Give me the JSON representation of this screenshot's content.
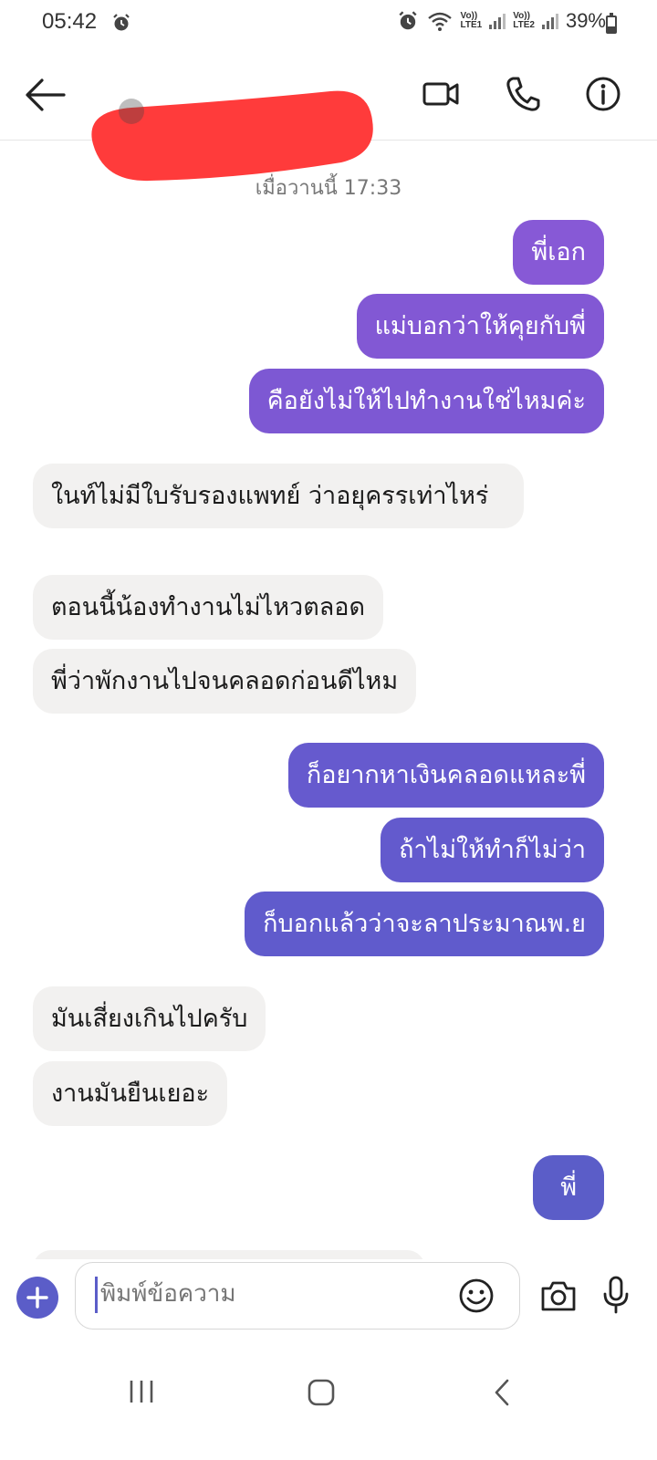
{
  "status_bar": {
    "time": "05:42",
    "lte1": "LTE1",
    "lte2": "LTE2",
    "vo1": "Vo))",
    "vo2": "Vo))",
    "battery_percent": "39%",
    "battery_level": 0.39,
    "icons": [
      "alarm-icon",
      "alarm-icon",
      "wifi-icon",
      "signal-icon",
      "signal-icon",
      "battery-icon"
    ]
  },
  "header": {
    "contact_name": "",
    "icons": [
      "back-arrow-icon",
      "video-call-icon",
      "phone-icon",
      "info-icon"
    ]
  },
  "chat": {
    "timestamp": "เมื่อวานนี้ 17:33",
    "messages": [
      {
        "direction": "out",
        "text": "พี่เอก"
      },
      {
        "direction": "out",
        "text": "แม่บอกว่าให้คุยกับพี่"
      },
      {
        "direction": "out",
        "text": "คือยังไม่ให้ไปทำงานใช่ไหมค่ะ"
      },
      {
        "direction": "in",
        "text": "ในท์ไม่มีใบรับรองแพทย์ ว่าอยุครรเท่าไหร่"
      },
      {
        "direction": "in",
        "text": "ตอนนี้น้องทำงานไม่ไหวตลอด"
      },
      {
        "direction": "in",
        "text": "พี่ว่าพักงานไปจนคลอดก่อนดีไหม"
      },
      {
        "direction": "out",
        "text": "ก็อยากหาเงินคลอดแหละพี่"
      },
      {
        "direction": "out",
        "text": "ถ้าไม่ให้ทำก็ไม่ว่า"
      },
      {
        "direction": "out",
        "text": "ก็บอกแล้วว่าจะลาประมาณพ.ย"
      },
      {
        "direction": "in",
        "text": "มันเสี่ยงเกินไปครับ"
      },
      {
        "direction": "in",
        "text": "งานมันยืนเยอะ"
      },
      {
        "direction": "out",
        "text": "พี่"
      }
    ]
  },
  "composer": {
    "placeholder": "พิมพ์ข้อความ",
    "icons": [
      "plus-icon",
      "emoji-icon",
      "camera-icon",
      "microphone-icon"
    ]
  },
  "navbar": {
    "icons": [
      "recents-icon",
      "home-icon",
      "back-icon"
    ]
  },
  "colors": {
    "accent": "#5b5dc8",
    "outgoing_top": "#8759d6",
    "outgoing_bottom": "#5b5dc8",
    "incoming_bg": "#f2f1f0",
    "redaction": "#ff3b3b"
  }
}
